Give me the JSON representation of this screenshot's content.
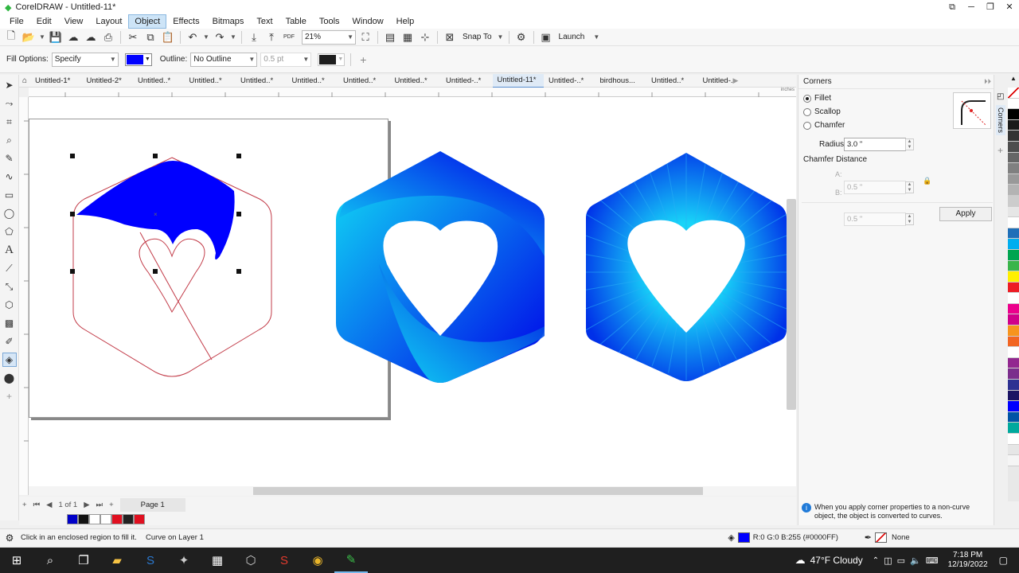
{
  "window": {
    "title": "CorelDRAW - Untitled-11*"
  },
  "menu": [
    "File",
    "Edit",
    "View",
    "Layout",
    "Object",
    "Effects",
    "Bitmaps",
    "Text",
    "Table",
    "Tools",
    "Window",
    "Help"
  ],
  "toolbar": {
    "zoom": "21%",
    "snap_to": "Snap To",
    "launch": "Launch",
    "pdf": "PDF"
  },
  "propbar": {
    "fill_options_label": "Fill Options:",
    "fill_options_value": "Specify",
    "fill_color": "#0000ff",
    "outline_label": "Outline:",
    "outline_value": "No Outline",
    "outline_width": "0.5 pt",
    "outline_color": "#1e1e1e"
  },
  "doc_tabs": [
    "Untitled-1*",
    "Untitled-2*",
    "Untitled..*",
    "Untitled..*",
    "Untitled..*",
    "Untitled..*",
    "Untitled..*",
    "Untitled..*",
    "Untitled-..*",
    "Untitled-11*",
    "Untitled-..*",
    "birdhous...",
    "Untitled..*",
    "Untitled-..*"
  ],
  "active_tab_index": 9,
  "ruler": {
    "units": "inches"
  },
  "pagebar": {
    "page_count": "1 of 1",
    "page_tab": "Page 1"
  },
  "docker": {
    "title": "Corners",
    "side_tab": "Corners",
    "options": [
      "Fillet",
      "Scallop",
      "Chamfer"
    ],
    "selected_option": "Fillet",
    "radius_label": "Radius:",
    "radius_value": "3.0 \"",
    "chamfer_label": "Chamfer Distance",
    "chamfer_a_label": "A:",
    "chamfer_a": "0.5 \"",
    "chamfer_b_label": "B:",
    "chamfer_b": "0.5 \"",
    "apply_label": "Apply",
    "info_text_1": "When you apply corner properties to a non-curve",
    "info_text_2": "object, the object is converted to curves."
  },
  "status": {
    "hint": "Click in an enclosed region to fill it.",
    "object_info": "Curve on Layer 1",
    "fill_readout": "R:0 G:0 B:255 (#0000FF)",
    "outline_readout": "None"
  },
  "taskbar": {
    "weather": "47°F  Cloudy",
    "time": "7:18 PM",
    "date": "12/19/2022"
  },
  "colors": {
    "accent": "#0000ff",
    "gradient_light": "#11e3f5",
    "gradient_dark": "#0000e8",
    "outline_red": "#c23b48"
  }
}
